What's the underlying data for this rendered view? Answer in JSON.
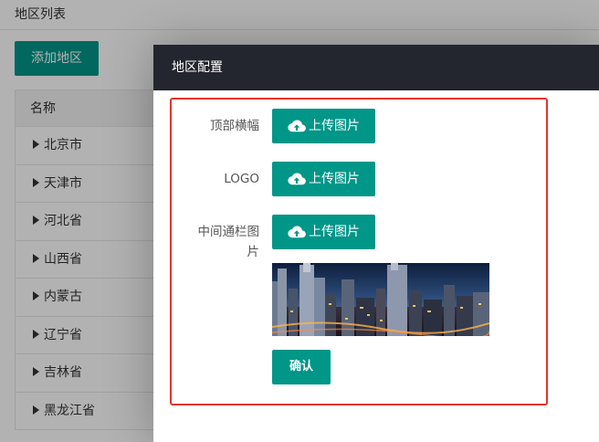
{
  "page": {
    "title": "地区列表",
    "add_button": "添加地区",
    "table_header": "名称",
    "regions": [
      "北京市",
      "天津市",
      "河北省",
      "山西省",
      "内蒙古",
      "辽宁省",
      "吉林省",
      "黑龙江省"
    ]
  },
  "dialog": {
    "title": "地区配置",
    "rows": [
      {
        "label": "顶部横幅",
        "button": "上传图片"
      },
      {
        "label": "LOGO",
        "button": "上传图片"
      },
      {
        "label": "中间通栏图片",
        "button": "上传图片"
      }
    ],
    "confirm": "确认"
  },
  "colors": {
    "primary": "#009688",
    "dialog_header": "#23262e",
    "highlight": "#e4342a"
  },
  "icons": {
    "upload": "cloud-upload-icon",
    "tree_toggle": "caret-right-icon"
  }
}
